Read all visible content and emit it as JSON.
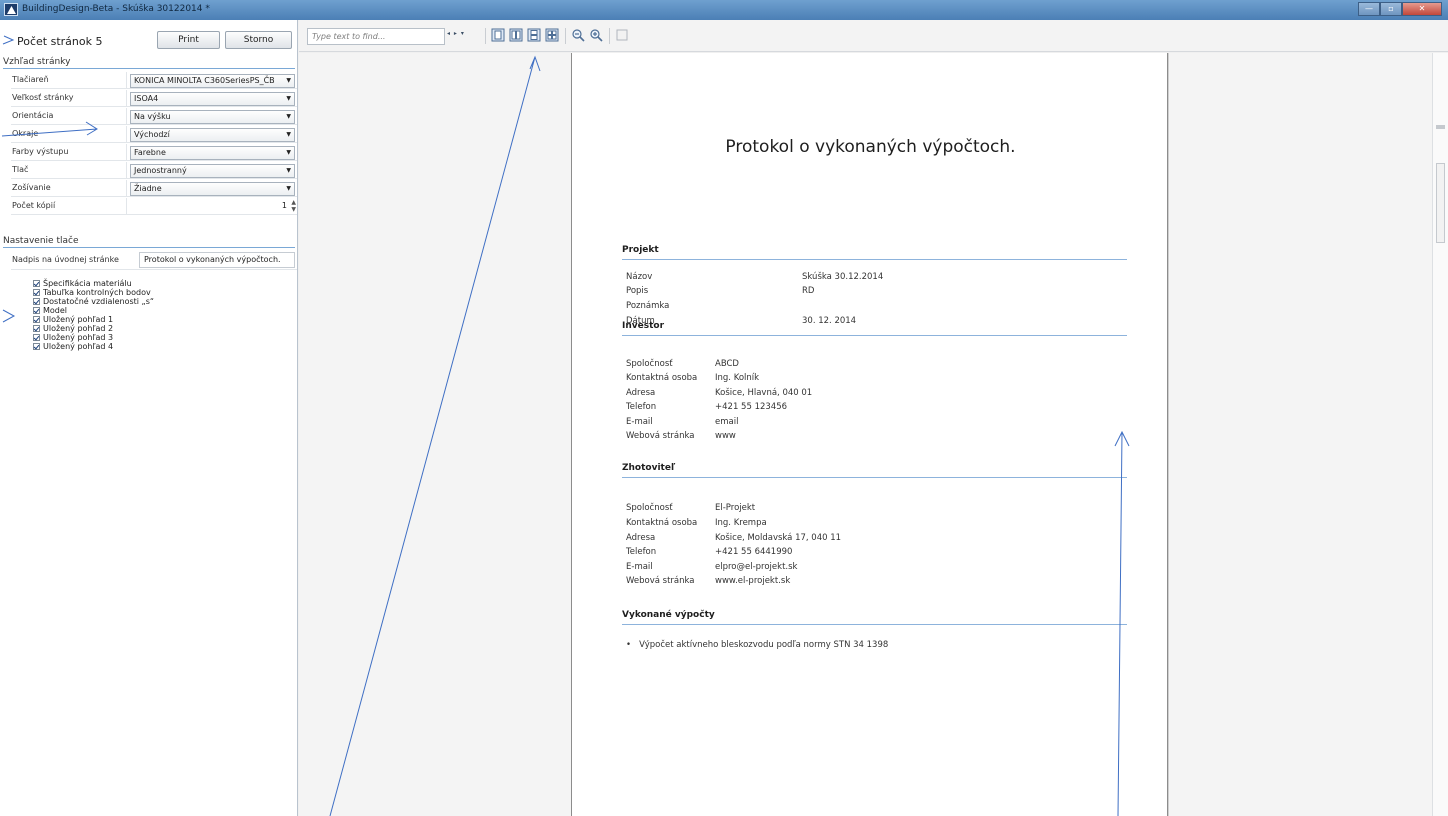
{
  "window": {
    "title": "BuildingDesign-Beta - Skúška 30122014 *",
    "controls": {
      "minimize": "—",
      "maximize": "▫",
      "close": "✕"
    }
  },
  "sidebar": {
    "page_count_label": "Počet stránok 5",
    "print_label": "Print",
    "cancel_label": "Storno",
    "section_view": "Vzhľad stránky",
    "properties": [
      {
        "label": "Tlačiareň",
        "value": "KONICA MINOLTA C360SeriesPS_ČB"
      },
      {
        "label": "Veľkosť stránky",
        "value": "ISOA4"
      },
      {
        "label": "Orientácia",
        "value": "Na výšku"
      },
      {
        "label": "Okraje",
        "value": "Východzí"
      },
      {
        "label": "Farby výstupu",
        "value": "Farebne"
      },
      {
        "label": "Tlač",
        "value": "Jednostranný"
      },
      {
        "label": "Zošívanie",
        "value": "Žiadne"
      }
    ],
    "copies_label": "Počet kópií",
    "copies_value": "1",
    "section_print": "Nastavenie tlače",
    "cover_title_label": "Nadpis na úvodnej stránke",
    "cover_title_value": "Protokol o vykonaných výpočtoch.",
    "checklist": [
      "Špecifikácia materiálu",
      "Tabuľka kontrolných bodov",
      "Dostatočné vzdialenosti „s“",
      "Model",
      "Uložený pohľad 1",
      "Uložený pohľad 2",
      "Uložený pohľad 3",
      "Uložený pohľad 4"
    ]
  },
  "toolbar": {
    "find_placeholder": "Type text to find...",
    "find_nav": "◂ ▸ ▾",
    "icons": [
      "single-page-icon",
      "facing-pages-icon",
      "continuous-pages-icon",
      "multi-page-icon",
      "zoom-out-icon",
      "zoom-in-icon",
      "export-icon"
    ]
  },
  "document": {
    "title": "Protokol o vykonaných výpočtoch.",
    "project": {
      "heading": "Projekt",
      "rows": [
        {
          "key": "Názov",
          "value": "Skúška 30.12.2014"
        },
        {
          "key": "Popis",
          "value": "RD"
        },
        {
          "key": "Poznámka",
          "value": ""
        },
        {
          "key": "Dátum",
          "value": "30. 12. 2014"
        }
      ]
    },
    "investor": {
      "heading": "Investor",
      "rows": [
        {
          "key": "Spoločnosť",
          "value": "ABCD"
        },
        {
          "key": "Kontaktná osoba",
          "value": "Ing. Kolník"
        },
        {
          "key": "Adresa",
          "value": "Košice, Hlavná, 040 01"
        },
        {
          "key": "Telefon",
          "value": "+421 55 123456"
        },
        {
          "key": "E-mail",
          "value": "email"
        },
        {
          "key": "Webová stránka",
          "value": "www"
        }
      ]
    },
    "contractor": {
      "heading": "Zhotoviteľ",
      "rows": [
        {
          "key": "Spoločnosť",
          "value": "El-Projekt"
        },
        {
          "key": "Kontaktná osoba",
          "value": "Ing. Krempa"
        },
        {
          "key": "Adresa",
          "value": "Košice, Moldavská 17, 040 11"
        },
        {
          "key": "Telefon",
          "value": "+421 55 6441990"
        },
        {
          "key": "E-mail",
          "value": "elpro@el-projekt.sk"
        },
        {
          "key": "Webová stránka",
          "value": "www.el-projekt.sk"
        }
      ]
    },
    "calculations": {
      "heading": "Vykonané výpočty",
      "items": [
        "Výpočet aktívneho bleskozvodu podľa normy STN 34 1398"
      ]
    }
  }
}
